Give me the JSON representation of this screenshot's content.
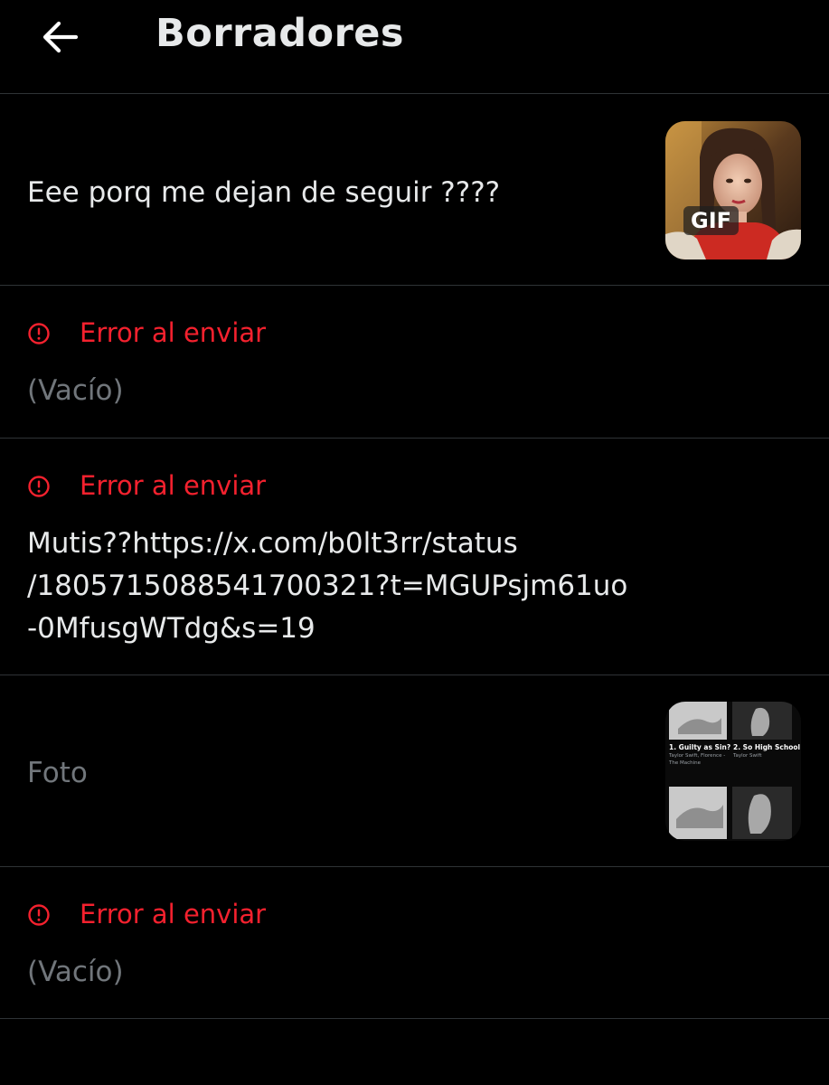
{
  "header": {
    "title": "Borradores",
    "back_icon": "arrow-left-icon"
  },
  "drafts": [
    {
      "text": "Eee porq me dejan de seguir ????",
      "media": "gif",
      "badge": "GIF"
    },
    {
      "error": "Error al enviar",
      "text": "(Vacío)"
    },
    {
      "error": "Error al enviar",
      "lines": [
        "Mutis??https://x.com/b0lt3rr/status",
        "/1805715088541700321?t=MGUPsjm61uo",
        "-0MfusgWTdg&s=19"
      ]
    },
    {
      "text": "Foto",
      "media": "photo",
      "tracks": [
        {
          "title": "1. Guilty as Sin?",
          "artist": "Taylor Swift, Florence -",
          "artist2": "The Machine"
        },
        {
          "title": "2. So High School",
          "artist": "Taylor Swift"
        }
      ]
    },
    {
      "error": "Error al enviar",
      "text": "(Vacío)"
    }
  ],
  "colors": {
    "background": "#000000",
    "divider": "#2f3336",
    "text": "#e7e9ea",
    "muted": "#71767b",
    "error": "#f4212e"
  }
}
